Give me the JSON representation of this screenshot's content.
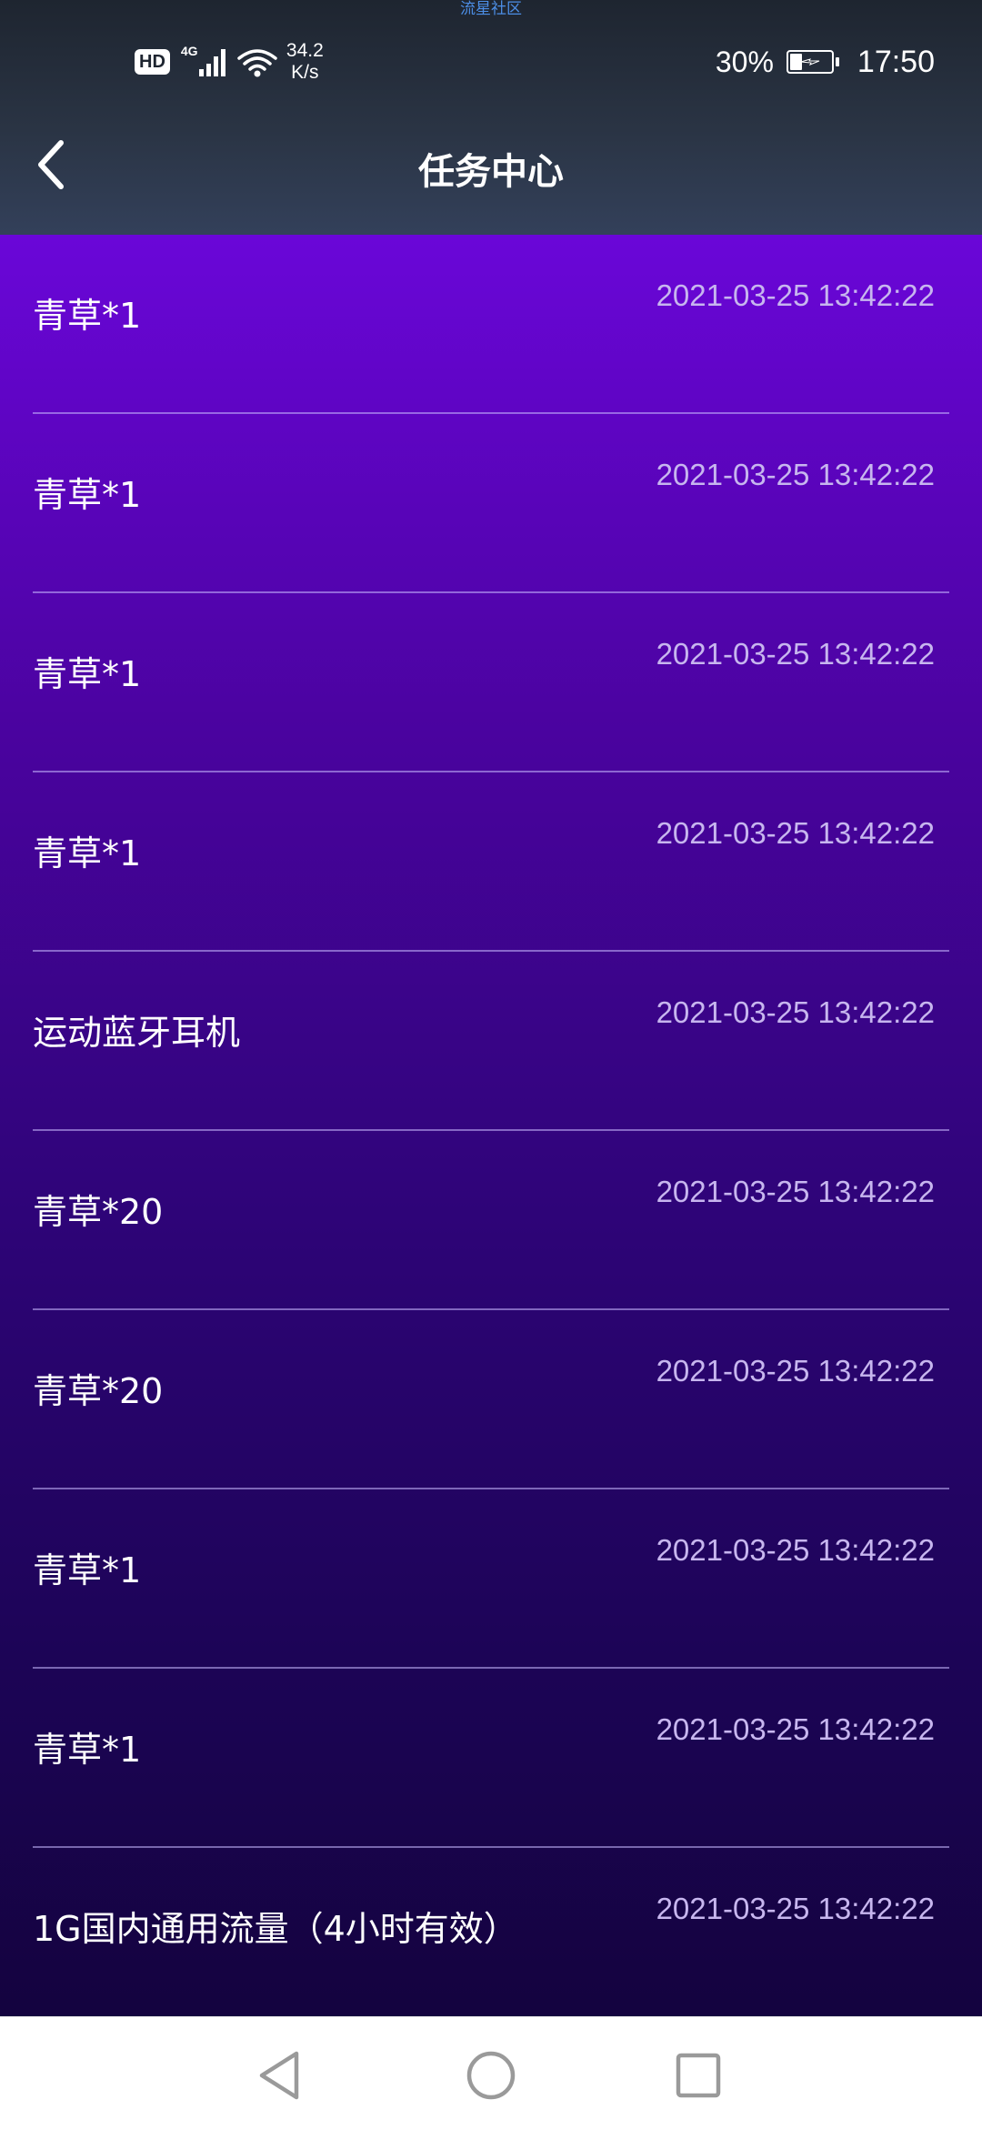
{
  "watermark": "流星社区",
  "status_bar": {
    "hd": "HD",
    "network": "4G",
    "speed_value": "34.2",
    "speed_unit": "K/s",
    "battery_percent": "30%",
    "battery_level": 0.3,
    "time": "17:50"
  },
  "app_bar": {
    "title": "任务中心",
    "back_icon": "chevron-left-icon"
  },
  "records": [
    {
      "name": "青草*1",
      "time": "2021-03-25 13:42:22"
    },
    {
      "name": "青草*1",
      "time": "2021-03-25 13:42:22"
    },
    {
      "name": "青草*1",
      "time": "2021-03-25 13:42:22"
    },
    {
      "name": "青草*1",
      "time": "2021-03-25 13:42:22"
    },
    {
      "name": "运动蓝牙耳机",
      "time": "2021-03-25 13:42:22"
    },
    {
      "name": "青草*20",
      "time": "2021-03-25 13:42:22"
    },
    {
      "name": "青草*20",
      "time": "2021-03-25 13:42:22"
    },
    {
      "name": "青草*1",
      "time": "2021-03-25 13:42:22"
    },
    {
      "name": "青草*1",
      "time": "2021-03-25 13:42:22"
    },
    {
      "name": "1G国内通用流量（4小时有效）",
      "time": "2021-03-25 13:42:22"
    }
  ],
  "colors": {
    "accent_top": "#6a06d8",
    "accent_bottom": "#14033f",
    "time_text": "#c7b6ef"
  },
  "nav_bar": {
    "back_icon": "triangle-back-icon",
    "home_icon": "circle-home-icon",
    "recents_icon": "square-recents-icon"
  }
}
